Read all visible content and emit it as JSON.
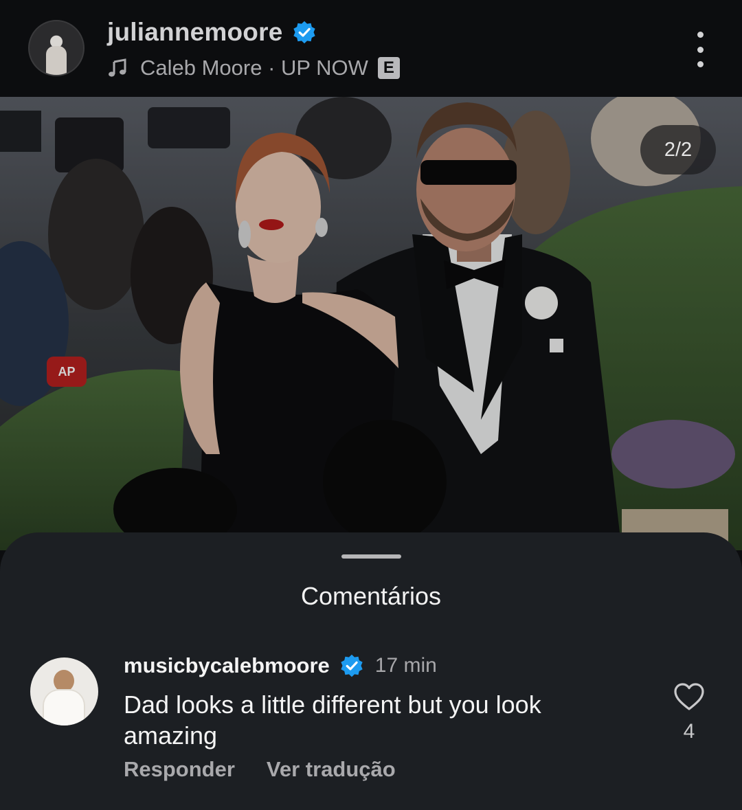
{
  "post": {
    "username": "juliannemoore",
    "music": {
      "artist": "Caleb Moore",
      "separator": " · ",
      "track": "UP NOW",
      "explicit_badge": "E"
    },
    "image_counter": "2/2"
  },
  "comments_sheet": {
    "title": "Comentários",
    "comments": [
      {
        "username": "musicbycalebmoore",
        "time": "17 min",
        "text": "Dad looks a little different but you look amazing",
        "reply_label": "Responder",
        "translate_label": "Ver tradução",
        "likes": "4"
      }
    ]
  },
  "icons": {
    "verified": "verified-badge-icon",
    "music": "music-note-icon",
    "more": "more-vertical-icon",
    "like": "heart-outline-icon"
  },
  "colors": {
    "background": "#0c0d0f",
    "sheet": "#1c1f23",
    "verified_blue": "#1d9bf0",
    "text_primary": "#f4f4f4",
    "text_secondary": "#a9a9ac"
  }
}
